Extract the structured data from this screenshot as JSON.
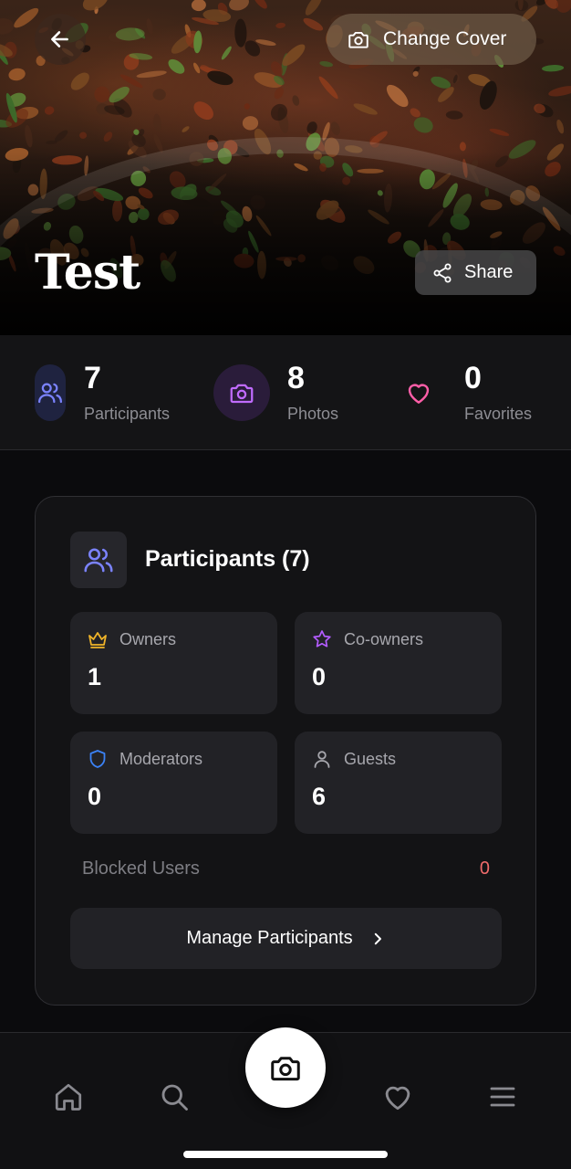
{
  "header": {
    "change_cover_label": "Change Cover",
    "title": "Test",
    "share_label": "Share"
  },
  "stats": [
    {
      "value": "7",
      "label": "Participants",
      "icon": "users-icon",
      "color": "#7b83ff"
    },
    {
      "value": "8",
      "label": "Photos",
      "icon": "camera-icon",
      "color": "#c06bff"
    },
    {
      "value": "0",
      "label": "Favorites",
      "icon": "heart-icon",
      "color": "#ff5ea8"
    }
  ],
  "participants_card": {
    "title": "Participants (7)",
    "roles": [
      {
        "label": "Owners",
        "value": "1",
        "icon": "crown-icon",
        "color": "#f0b429"
      },
      {
        "label": "Co-owners",
        "value": "0",
        "icon": "star-icon",
        "color": "#b35cff"
      },
      {
        "label": "Moderators",
        "value": "0",
        "icon": "shield-icon",
        "color": "#3b82f6"
      },
      {
        "label": "Guests",
        "value": "6",
        "icon": "user-icon",
        "color": "#a7a7ad"
      }
    ],
    "blocked_label": "Blocked Users",
    "blocked_value": "0",
    "manage_label": "Manage Participants"
  },
  "nav": {
    "items": [
      {
        "icon": "home-icon"
      },
      {
        "icon": "search-icon"
      },
      {
        "icon": "camera-icon"
      },
      {
        "icon": "heart-icon"
      },
      {
        "icon": "menu-icon"
      }
    ]
  }
}
